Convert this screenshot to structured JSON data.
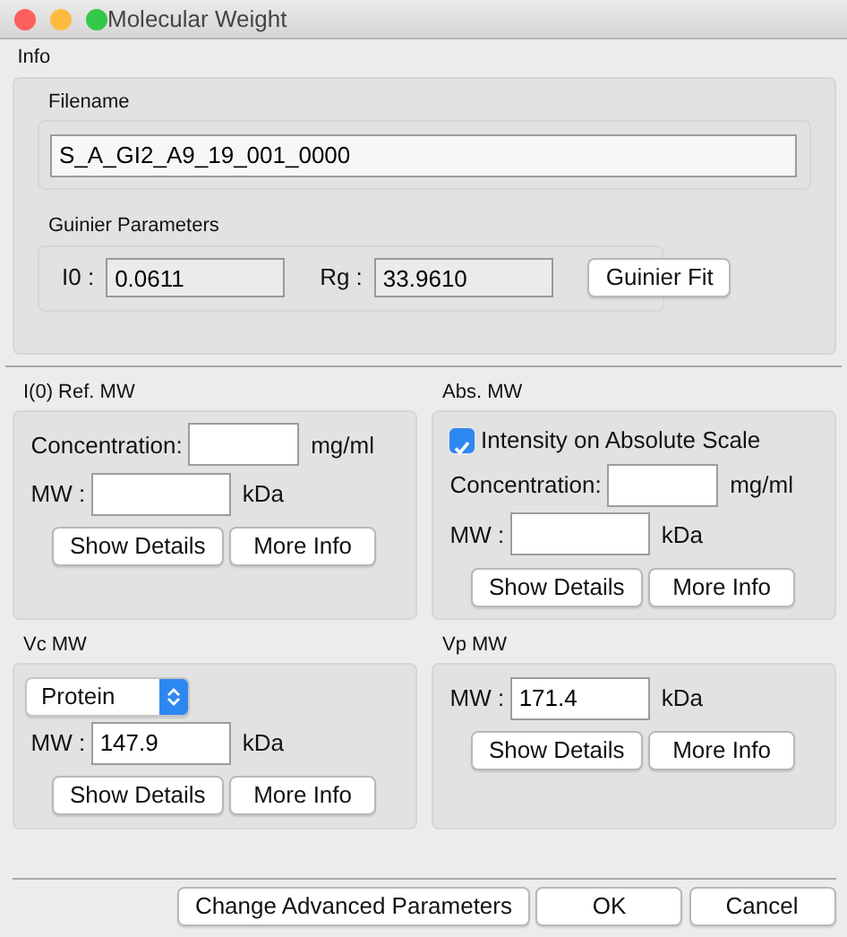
{
  "window": {
    "title": "Molecular Weight"
  },
  "info": {
    "title": "Info",
    "filename": {
      "label": "Filename",
      "value": "S_A_GI2_A9_19_001_0000"
    },
    "guinier": {
      "title": "Guinier Parameters",
      "fields": [
        {
          "label": "I0 :",
          "value": "0.0611"
        },
        {
          "label": "Rg :",
          "value": "33.9610"
        }
      ],
      "button": "Guinier Fit"
    }
  },
  "panels": [
    {
      "title": "I(0) Ref. MW",
      "items": [
        {
          "kind": "field",
          "label": "Concentration:",
          "unit": "mg/ml"
        },
        {
          "kind": "field",
          "label": "MW :",
          "unit": "kDa"
        },
        {
          "kind": "buttons",
          "buttons": [
            "Show Details",
            "More Info"
          ]
        }
      ]
    },
    {
      "title": "Abs. MW",
      "items": [
        {
          "kind": "checkbox",
          "label": "Intensity on Absolute Scale",
          "checked": true
        },
        {
          "kind": "field",
          "label": "Concentration:",
          "unit": "mg/ml"
        },
        {
          "kind": "field",
          "label": "MW :",
          "unit": "kDa"
        },
        {
          "kind": "buttons",
          "buttons": [
            "Show Details",
            "More Info"
          ]
        }
      ]
    },
    {
      "title": "Vc MW",
      "items": [
        {
          "kind": "select",
          "value": "Protein"
        },
        {
          "kind": "field",
          "label": "MW :",
          "value": "147.9",
          "unit": "kDa"
        },
        {
          "kind": "buttons",
          "buttons": [
            "Show Details",
            "More Info"
          ]
        }
      ]
    },
    {
      "title": "Vp MW",
      "items": [
        {
          "kind": "field",
          "label": "MW :",
          "value": "171.4",
          "unit": "kDa"
        },
        {
          "kind": "buttons",
          "buttons": [
            "Show Details",
            "More Info"
          ]
        }
      ]
    }
  ],
  "buttons": [
    "Change Advanced Parameters",
    "OK",
    "Cancel"
  ]
}
